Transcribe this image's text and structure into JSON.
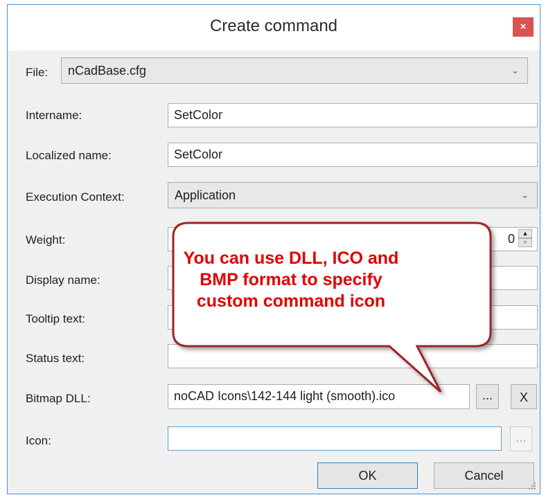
{
  "window": {
    "title": "Create command",
    "close_glyph": "×"
  },
  "file": {
    "label": "File:",
    "value": "nCadBase.cfg"
  },
  "intername": {
    "label": "Intername:",
    "value": "SetColor"
  },
  "localized_name": {
    "label": "Localized name:",
    "value": "SetColor"
  },
  "execution_context": {
    "label": "Execution Context:",
    "value": "Application"
  },
  "weight": {
    "label": "Weight:",
    "value": "0"
  },
  "display_name": {
    "label": "Display name:",
    "value": ""
  },
  "tooltip_text": {
    "label": "Tooltip text:",
    "value": ""
  },
  "status_text": {
    "label": "Status text:",
    "value": ""
  },
  "bitmap_dll": {
    "label": "Bitmap DLL:",
    "value": "noCAD Icons\\142-144 light (smooth).ico",
    "browse_label": "...",
    "clear_label": "X"
  },
  "icon": {
    "label": "Icon:",
    "value": "",
    "browse_label": "..."
  },
  "buttons": {
    "ok": "OK",
    "cancel": "Cancel"
  },
  "callout": {
    "lines": [
      "You can use DLL, ICO and",
      "BMP format to specify",
      "custom command icon"
    ],
    "color": "#e00000"
  },
  "colors": {
    "accent": "#4a8fd6",
    "close": "#d9534f"
  }
}
